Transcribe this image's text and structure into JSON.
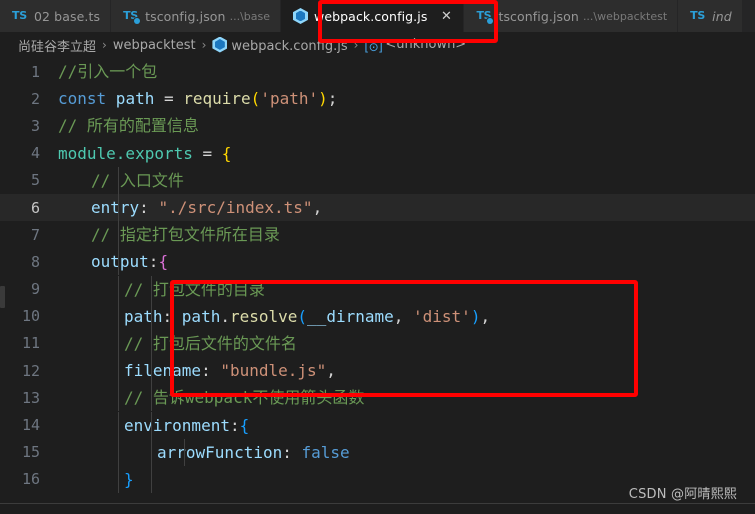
{
  "window": {
    "theme_background": "#1e1e1e",
    "accent_red": "#ff0000"
  },
  "tabs": [
    {
      "icon": "typescript-icon",
      "label": "02 base.ts",
      "description": "",
      "active": false,
      "preview": false,
      "closable": false
    },
    {
      "icon": "tsconfig-icon",
      "label": "tsconfig.json",
      "description": "...\\base",
      "active": false,
      "preview": false,
      "closable": false
    },
    {
      "icon": "webpack-icon",
      "label": "webpack.config.js",
      "description": "",
      "active": true,
      "preview": false,
      "closable": true,
      "close_label": "✕"
    },
    {
      "icon": "tsconfig-icon",
      "label": "tsconfig.json",
      "description": "...\\webpacktest",
      "active": false,
      "preview": false,
      "closable": false
    },
    {
      "icon": "typescript-icon",
      "label": "ind",
      "description": "",
      "active": false,
      "preview": true,
      "closable": false
    }
  ],
  "breadcrumb": {
    "separator": "›",
    "items": [
      {
        "label": "尚硅谷李立超",
        "icon": ""
      },
      {
        "label": "webpacktest",
        "icon": ""
      },
      {
        "label": "webpack.config.js",
        "icon": "webpack-icon"
      },
      {
        "label": "<unknown>",
        "icon": "symbol-icon"
      }
    ]
  },
  "editor": {
    "language": "javascript",
    "active_line": 6,
    "lines": [
      {
        "n": "1",
        "indent": 0,
        "tokens": [
          {
            "t": "//引入一个包",
            "c": "c"
          }
        ]
      },
      {
        "n": "2",
        "indent": 0,
        "tokens": [
          {
            "t": "const",
            "c": "kw"
          },
          {
            "t": " path ",
            "c": "var"
          },
          {
            "t": "= ",
            "c": "op"
          },
          {
            "t": "require",
            "c": "fn"
          },
          {
            "t": "(",
            "c": "br"
          },
          {
            "t": "'path'",
            "c": "str"
          },
          {
            "t": ")",
            "c": "br"
          },
          {
            "t": ";",
            "c": "op"
          }
        ]
      },
      {
        "n": "3",
        "indent": 0,
        "tokens": [
          {
            "t": "// 所有的配置信息",
            "c": "c"
          }
        ]
      },
      {
        "n": "4",
        "indent": 0,
        "tokens": [
          {
            "t": "module.exports ",
            "c": "cls"
          },
          {
            "t": "= ",
            "c": "op"
          },
          {
            "t": "{",
            "c": "br"
          }
        ]
      },
      {
        "n": "5",
        "indent": 1,
        "tokens": [
          {
            "t": "// 入口文件",
            "c": "c"
          }
        ]
      },
      {
        "n": "6",
        "indent": 1,
        "tokens": [
          {
            "t": "entry",
            "c": "var"
          },
          {
            "t": ": ",
            "c": "op"
          },
          {
            "t": "\"./src/index.ts\"",
            "c": "str"
          },
          {
            "t": ",",
            "c": "op"
          }
        ]
      },
      {
        "n": "7",
        "indent": 1,
        "tokens": [
          {
            "t": "// 指定打包文件所在目录",
            "c": "c"
          }
        ]
      },
      {
        "n": "8",
        "indent": 1,
        "tokens": [
          {
            "t": "output",
            "c": "var"
          },
          {
            "t": ":",
            "c": "op"
          },
          {
            "t": "{",
            "c": "br2"
          }
        ]
      },
      {
        "n": "9",
        "indent": 2,
        "tokens": [
          {
            "t": "// 打包文件的目录",
            "c": "c"
          }
        ]
      },
      {
        "n": "10",
        "indent": 2,
        "tokens": [
          {
            "t": "path",
            "c": "var"
          },
          {
            "t": ": ",
            "c": "op"
          },
          {
            "t": "path",
            "c": "var"
          },
          {
            "t": ".",
            "c": "op"
          },
          {
            "t": "resolve",
            "c": "fn"
          },
          {
            "t": "(",
            "c": "br3"
          },
          {
            "t": "__dirname",
            "c": "var"
          },
          {
            "t": ", ",
            "c": "op"
          },
          {
            "t": "'dist'",
            "c": "str"
          },
          {
            "t": ")",
            "c": "br3"
          },
          {
            "t": ",",
            "c": "op"
          }
        ]
      },
      {
        "n": "11",
        "indent": 2,
        "tokens": [
          {
            "t": "// 打包后文件的文件名",
            "c": "c"
          }
        ]
      },
      {
        "n": "12",
        "indent": 2,
        "tokens": [
          {
            "t": "filename",
            "c": "var"
          },
          {
            "t": ": ",
            "c": "op"
          },
          {
            "t": "\"bundle.js\"",
            "c": "str"
          },
          {
            "t": ",",
            "c": "op"
          }
        ]
      },
      {
        "n": "13",
        "indent": 2,
        "tokens": [
          {
            "t": "// 告诉webpack不使用箭头函数",
            "c": "c"
          }
        ]
      },
      {
        "n": "14",
        "indent": 2,
        "tokens": [
          {
            "t": "environment",
            "c": "var"
          },
          {
            "t": ":",
            "c": "op"
          },
          {
            "t": "{",
            "c": "br3"
          }
        ]
      },
      {
        "n": "15",
        "indent": 3,
        "tokens": [
          {
            "t": "arrowFunction",
            "c": "var"
          },
          {
            "t": ": ",
            "c": "op"
          },
          {
            "t": "false",
            "c": "num"
          }
        ]
      },
      {
        "n": "16",
        "indent": 2,
        "tokens": [
          {
            "t": "}",
            "c": "br3"
          }
        ]
      }
    ]
  },
  "annotations": [
    {
      "name": "active-tab-highlight",
      "color": "#ff0000"
    },
    {
      "name": "output-path-highlight",
      "color": "#ff0000"
    }
  ],
  "watermark": {
    "text": "CSDN @阿晴熙熙"
  }
}
